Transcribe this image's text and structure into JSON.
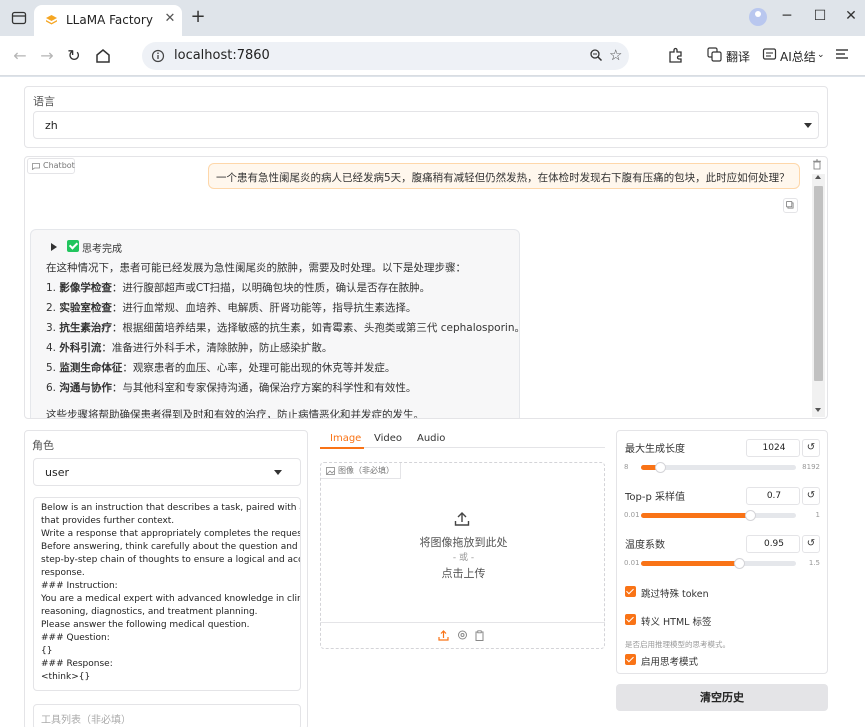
{
  "browser": {
    "tab_title": "LLaMA Factory V",
    "url": "localhost:7860",
    "translate_label": "翻译",
    "ai_summary_label": "AI总结"
  },
  "language": {
    "label": "语言",
    "value": "zh"
  },
  "chatbot": {
    "label": "Chatbot",
    "user_message": "一个患有急性阑尾炎的病人已经发病5天，腹痛稍有减轻但仍然发热，在体检时发现右下腹有压痛的包块，此时应如何处理？",
    "thinking_label": "思考完成",
    "intro": "在这种情况下，患者可能已经发展为急性阑尾炎的脓肿，需要及时处理。以下是处理步骤：",
    "steps": [
      {
        "num": "1.",
        "title": "影像学检查",
        "text": "：进行腹部超声或CT扫描，以明确包块的性质，确认是否存在脓肿。"
      },
      {
        "num": "2.",
        "title": "实验室检查",
        "text": "：进行血常规、血培养、电解质、肝肾功能等，指导抗生素选择。"
      },
      {
        "num": "3.",
        "title": "抗生素治疗",
        "text": "：根据细菌培养结果，选择敏感的抗生素，如青霉素、头孢类或第三代 cephalosporin。"
      },
      {
        "num": "4.",
        "title": "外科引流",
        "text": "：准备进行外科手术，清除脓肿，防止感染扩散。"
      },
      {
        "num": "5.",
        "title": "监测生命体征",
        "text": "：观察患者的血压、心率，处理可能出现的休克等并发症。"
      },
      {
        "num": "6.",
        "title": "沟通与协作",
        "text": "：与其他科室和专家保持沟通，确保治疗方案的科学性和有效性。"
      }
    ],
    "conclusion": "这些步骤将帮助确保患者得到及时和有效的治疗，防止病情恶化和并发症的发生。"
  },
  "role": {
    "label": "角色",
    "value": "user"
  },
  "system_prompt": {
    "lines": [
      "Below is an instruction that describes a task, paired with an input",
      "that provides further context.",
      "Write a response that appropriately completes the request.",
      "Before answering, think carefully about the question and create a",
      "step-by-step chain of thoughts to ensure a logical and accurate",
      "response.",
      "### Instruction:",
      "You are a medical expert with advanced knowledge in clinical",
      "reasoning, diagnostics, and treatment planning.",
      "Please answer the following medical question.",
      "### Question:",
      "{}",
      "### Response:",
      "<think>{}"
    ]
  },
  "tools": {
    "placeholder": "工具列表（非必填）"
  },
  "media": {
    "tabs": [
      "Image",
      "Video",
      "Audio"
    ],
    "active_tab": "Image",
    "image_label": "图像（非必填）",
    "drop_text": "将图像拖放到此处",
    "or_text": "- 或 -",
    "click_text": "点击上传"
  },
  "generation": {
    "max_new_tokens": {
      "label": "最大生成长度",
      "value": "1024",
      "min": "8",
      "max": "8192",
      "fraction": 0.12
    },
    "top_p": {
      "label": "Top-p 采样值",
      "value": "0.7",
      "min": "0.01",
      "max": "1",
      "fraction": 0.7
    },
    "temperature": {
      "label": "温度系数",
      "value": "0.95",
      "min": "0.01",
      "max": "1.5",
      "fraction": 0.63
    },
    "skip_special_tokens": {
      "label": "跳过特殊 token",
      "checked": true
    },
    "escape_html": {
      "label": "转义 HTML 标签",
      "checked": true
    },
    "thinking_hint": "是否启用推理模型的思考模式。",
    "enable_thinking": {
      "label": "启用思考模式",
      "checked": true
    }
  },
  "clear_history_label": "清空历史",
  "colors": {
    "accent": "#f97316",
    "user_bubble_bg": "#fff7ed",
    "bot_bubble_bg": "#f7f7f8"
  }
}
